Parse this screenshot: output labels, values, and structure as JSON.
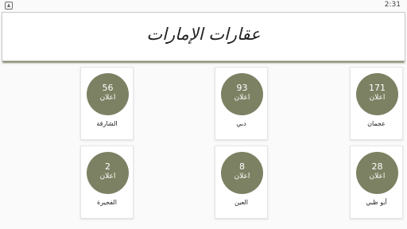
{
  "status_bar": {
    "time": "2:31",
    "notification_icon": "android-notification-icon"
  },
  "header": {
    "title": "عقارات الإمارات"
  },
  "ads_label": "اعلان",
  "emirates": [
    {
      "name": "الشارقة",
      "count": "56"
    },
    {
      "name": "دبي",
      "count": "93"
    },
    {
      "name": "عجمان",
      "count": "171"
    },
    {
      "name": "الفجيرة",
      "count": "2"
    },
    {
      "name": "العين",
      "count": "8"
    },
    {
      "name": "أبو ظبي",
      "count": "28"
    }
  ],
  "colors": {
    "circle": "#7d8163",
    "header_shadow": "#7b7f5f"
  }
}
